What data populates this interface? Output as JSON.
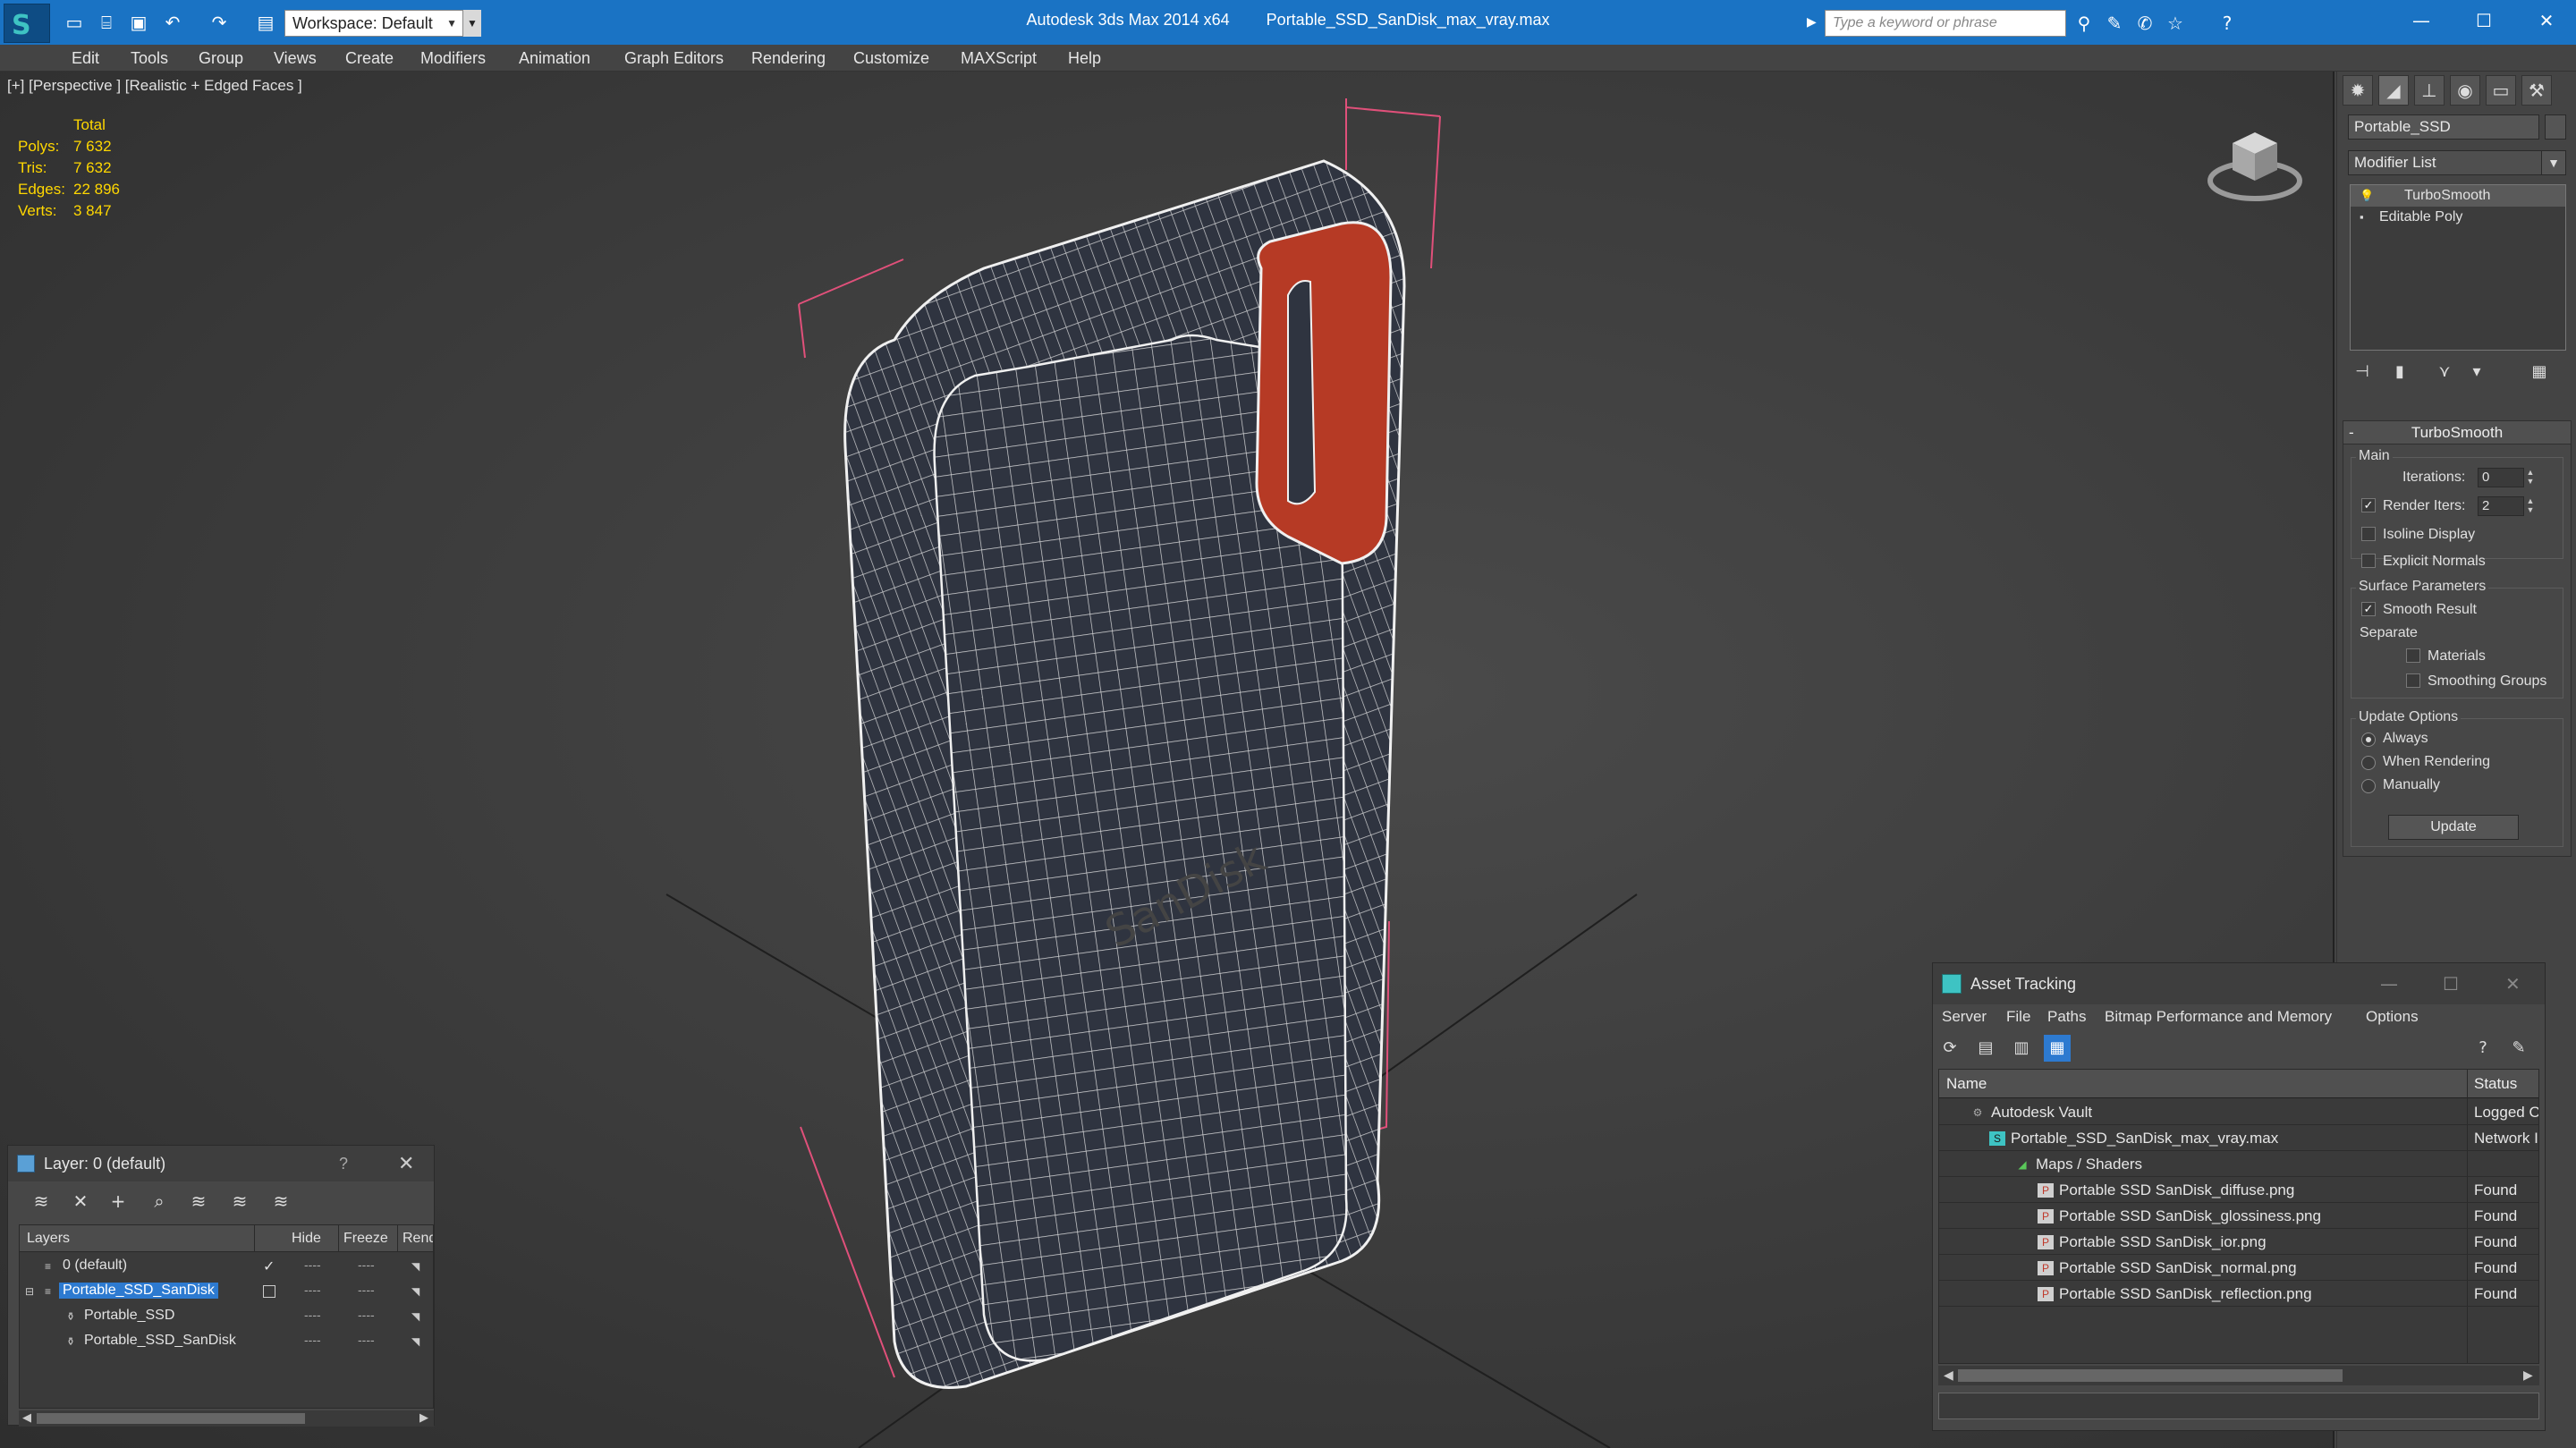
{
  "titlebar": {
    "app_name": "Autodesk 3ds Max  2014 x64",
    "file_name": "Portable_SSD_SanDisk_max_vray.max",
    "workspace": "Workspace: Default",
    "search_placeholder": "Type a keyword or phrase",
    "color": "#1a73c4"
  },
  "menubar": {
    "items": [
      "Edit",
      "Tools",
      "Group",
      "Views",
      "Create",
      "Modifiers",
      "Animation",
      "Graph Editors",
      "Rendering",
      "Customize",
      "MAXScript",
      "Help"
    ]
  },
  "viewport": {
    "label": "[+] [Perspective ] [Realistic + Edged Faces ]",
    "stats": {
      "header": "Total",
      "rows": [
        {
          "label": "Polys:",
          "value": "7 632"
        },
        {
          "label": "Tris:",
          "value": "7 632"
        },
        {
          "label": "Edges:",
          "value": "22 896"
        },
        {
          "label": "Verts:",
          "value": "3 847"
        }
      ],
      "color": "#ffd700"
    },
    "model_color": "#2f3440",
    "accent_color": "#c0392b",
    "bbox_color": "#e0507a"
  },
  "command_panel": {
    "tabs": [
      "create-icon",
      "modify-icon",
      "hierarchy-icon",
      "motion-icon",
      "display-icon",
      "utilities-icon"
    ],
    "object_name": "Portable_SSD",
    "modifier_list": "Modifier List",
    "stack": [
      {
        "label": "TurboSmooth",
        "selected": true
      },
      {
        "label": "Editable Poly",
        "selected": false
      }
    ],
    "turbosmooth": {
      "title": "TurboSmooth",
      "main_group": "Main",
      "iterations_label": "Iterations:",
      "iterations_value": "0",
      "render_iters_label": "Render Iters:",
      "render_iters_value": "2",
      "render_iters_checked": true,
      "isoline_label": "Isoline Display",
      "explicit_normals_label": "Explicit Normals",
      "surface_group": "Surface Parameters",
      "smooth_result_label": "Smooth Result",
      "smooth_result_checked": true,
      "separate_label": "Separate",
      "materials_label": "Materials",
      "smoothing_groups_label": "Smoothing Groups",
      "update_group": "Update Options",
      "always_label": "Always",
      "when_rendering_label": "When Rendering",
      "manually_label": "Manually",
      "update_button": "Update"
    }
  },
  "layer_dialog": {
    "title": "Layer: 0 (default)",
    "help": "?",
    "columns": [
      "Layers",
      "Hide",
      "Freeze",
      "Rend"
    ],
    "rows": [
      {
        "name": "0 (default)",
        "check": "✓"
      },
      {
        "name": "Portable_SSD_SanDisk",
        "selected": true
      },
      {
        "name": "Portable_SSD"
      },
      {
        "name": "Portable_SSD_SanDisk"
      }
    ],
    "dash": "----"
  },
  "asset_dialog": {
    "title": "Asset Tracking",
    "menu": [
      "Server",
      "File",
      "Paths",
      "Bitmap Performance and Memory",
      "Options"
    ],
    "columns": [
      "Name",
      "Status"
    ],
    "rows": [
      {
        "name": "Autodesk Vault",
        "status": "Logged O",
        "icon": "vault-icon"
      },
      {
        "name": "Portable_SSD_SanDisk_max_vray.max",
        "status": "Network I",
        "icon": "max-file-icon"
      },
      {
        "name": "Maps / Shaders",
        "status": "",
        "icon": "maps-icon"
      },
      {
        "name": "Portable SSD SanDisk_diffuse.png",
        "status": "Found",
        "icon": "png-icon"
      },
      {
        "name": "Portable SSD SanDisk_glossiness.png",
        "status": "Found",
        "icon": "png-icon"
      },
      {
        "name": "Portable SSD SanDisk_ior.png",
        "status": "Found",
        "icon": "png-icon"
      },
      {
        "name": "Portable SSD SanDisk_normal.png",
        "status": "Found",
        "icon": "png-icon"
      },
      {
        "name": "Portable SSD SanDisk_reflection.png",
        "status": "Found",
        "icon": "png-icon"
      }
    ]
  }
}
